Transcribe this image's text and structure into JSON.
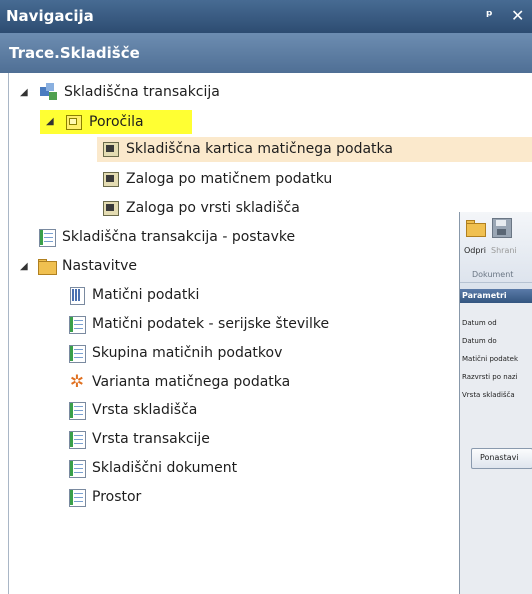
{
  "nav": {
    "title": "Navigacija",
    "pin": "ᵖ",
    "close": "✕",
    "subtitle": "Trace.Skladišče"
  },
  "tree": [
    {
      "label": "Skladiščna transakcija",
      "icon": "transaction-icon",
      "expanded": true
    },
    {
      "label": "Poročila",
      "icon": "report-folder-icon",
      "expanded": true,
      "highlighted": true
    },
    {
      "label": "Skladiščna kartica matičnega podatka",
      "icon": "report-icon",
      "hovered": true
    },
    {
      "label": "Zaloga po matičnem podatku",
      "icon": "report-icon"
    },
    {
      "label": "Zaloga po vrsti skladišča",
      "icon": "report-icon"
    },
    {
      "label": "Skladiščna transakcija - postavke",
      "icon": "table-icon"
    },
    {
      "label": "Nastavitve",
      "icon": "folder-icon",
      "expanded": true
    },
    {
      "label": "Matični podatki",
      "icon": "calendar-table-icon"
    },
    {
      "label": "Matični podatek - serijske številke",
      "icon": "table-icon"
    },
    {
      "label": "Skupina matičnih podatkov",
      "icon": "table-icon"
    },
    {
      "label": "Varianta matičnega podatka",
      "icon": "variant-icon"
    },
    {
      "label": "Vrsta skladišča",
      "icon": "table-icon"
    },
    {
      "label": "Vrsta transakcije",
      "icon": "table-icon"
    },
    {
      "label": "Skladiščni dokument",
      "icon": "table-icon"
    },
    {
      "label": "Prostor",
      "icon": "table-icon"
    }
  ],
  "right_panel": {
    "open_label": "Odpri",
    "save_label": "Shrani",
    "group_label": "Dokument",
    "params_title": "Parametri",
    "fields": [
      "Datum od",
      "Datum do",
      "Matični podatek",
      "Razvrsti po nazi",
      "Vrsta skladišča"
    ],
    "reset_label": "Ponastavi"
  },
  "colors": {
    "titlebar": "#3a5d86",
    "highlight": "#ffff33",
    "hover": "#fbe9cc"
  }
}
